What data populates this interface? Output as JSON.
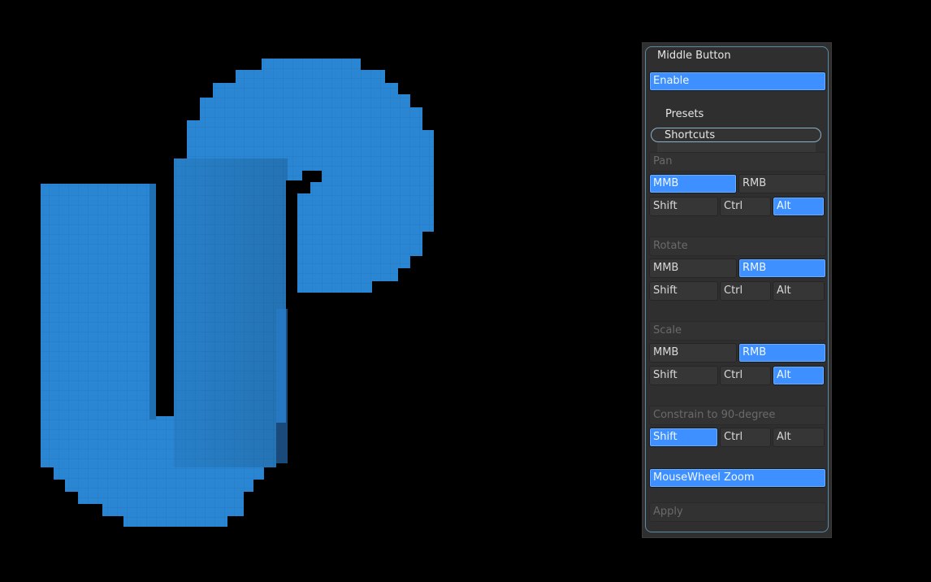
{
  "viewport": {
    "object_name": "voxel-s-shape",
    "color": "#2a86d2"
  },
  "panel": {
    "title": "Middle Button",
    "enable_label": "Enable",
    "presets_label": "Presets",
    "shortcuts_label": "Shortcuts",
    "pan": {
      "header": "Pan",
      "mmb": "MMB",
      "rmb": "RMB",
      "shift": "Shift",
      "ctrl": "Ctrl",
      "alt": "Alt"
    },
    "rotate": {
      "header": "Rotate",
      "mmb": "MMB",
      "rmb": "RMB",
      "shift": "Shift",
      "ctrl": "Ctrl",
      "alt": "Alt"
    },
    "scale": {
      "header": "Scale",
      "mmb": "MMB",
      "rmb": "RMB",
      "shift": "Shift",
      "ctrl": "Ctrl",
      "alt": "Alt"
    },
    "constrain": {
      "header": "Constrain to 90-degree",
      "shift": "Shift",
      "ctrl": "Ctrl",
      "alt": "Alt"
    },
    "mousewheel_zoom_label": "MouseWheel Zoom",
    "apply_label": "Apply",
    "accent": "#3e8fff"
  }
}
